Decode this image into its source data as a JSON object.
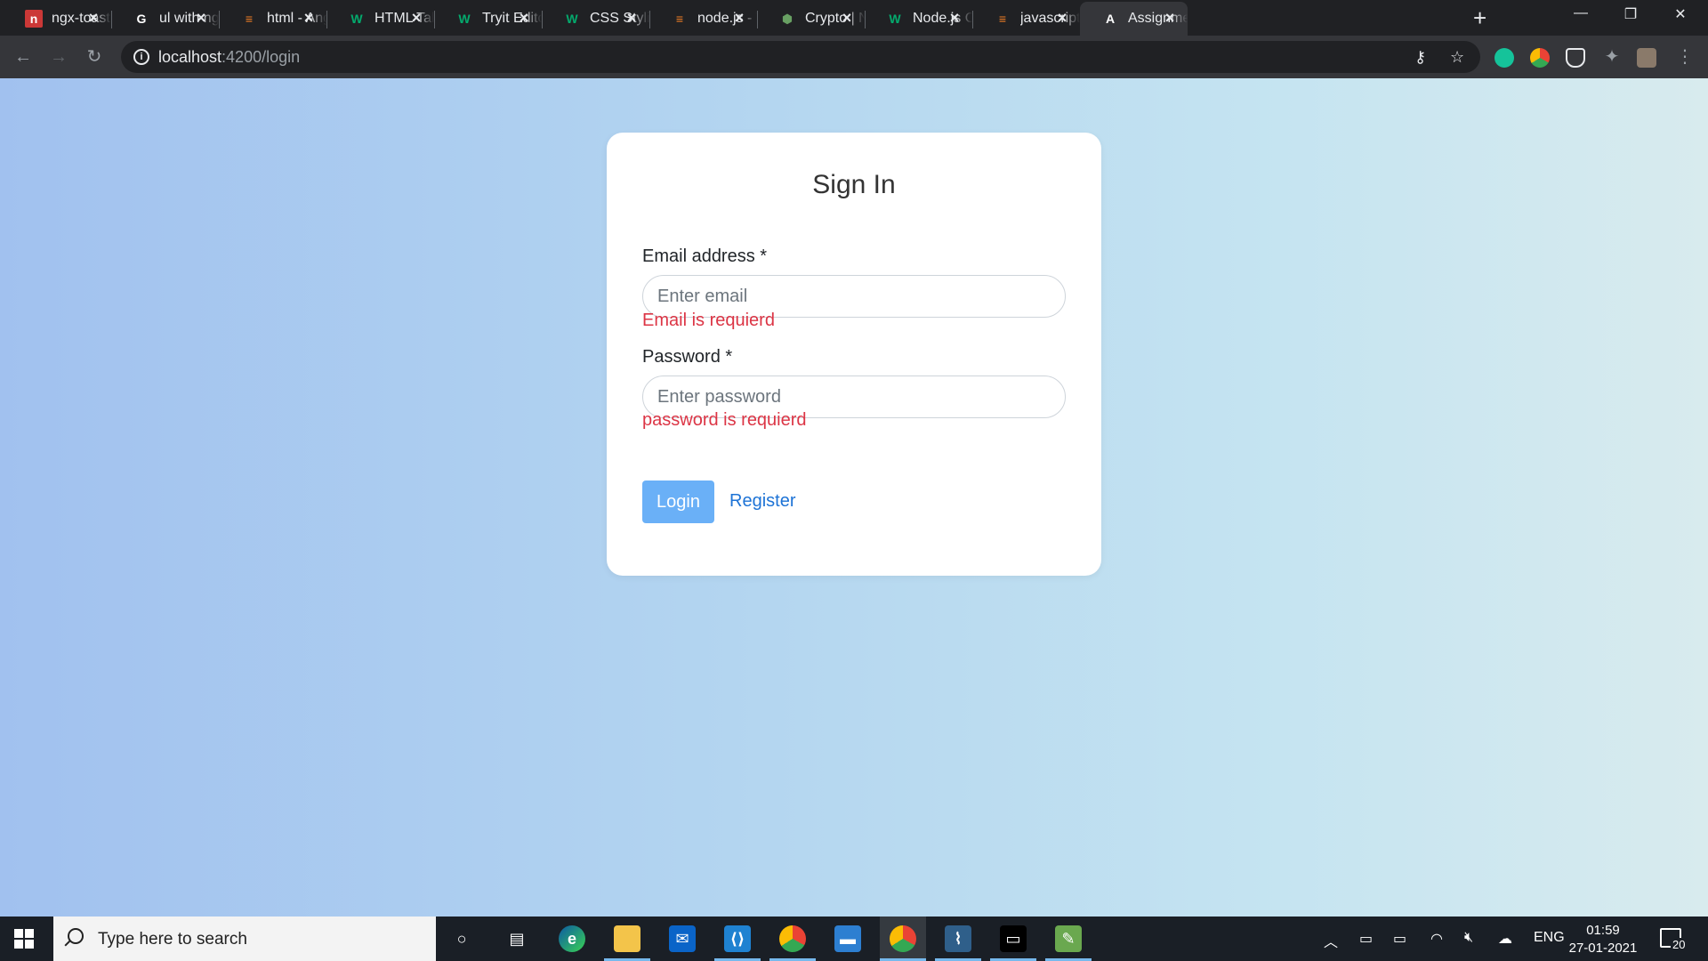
{
  "browser": {
    "tabs": [
      {
        "title": "ngx-toastr",
        "favicon": "npm-icon",
        "color": "#cb3837",
        "glyph": "n"
      },
      {
        "title": "ul with ngFor",
        "favicon": "google-icon",
        "color": "#ffffff",
        "glyph": "G"
      },
      {
        "title": "html - Angular",
        "favicon": "stackoverflow-icon",
        "color": "#f48024",
        "glyph": "≡"
      },
      {
        "title": "HTML Tables",
        "favicon": "w3schools-icon",
        "color": "#04aa6d",
        "glyph": "W"
      },
      {
        "title": "Tryit Editor",
        "favicon": "w3schools-icon",
        "color": "#04aa6d",
        "glyph": "W"
      },
      {
        "title": "CSS Styling",
        "favicon": "w3schools-icon",
        "color": "#04aa6d",
        "glyph": "W"
      },
      {
        "title": "node.js - T",
        "favicon": "stackoverflow-icon",
        "color": "#f48024",
        "glyph": "≡"
      },
      {
        "title": "Crypto | Node",
        "favicon": "nodejs-icon",
        "color": "#68a063",
        "glyph": "⬢"
      },
      {
        "title": "Node.js Crypto",
        "favicon": "w3schools-icon",
        "color": "#04aa6d",
        "glyph": "W"
      },
      {
        "title": "javascript",
        "favicon": "stackoverflow-icon",
        "color": "#f48024",
        "glyph": "≡"
      },
      {
        "title": "Assignment",
        "favicon": "angular-icon",
        "color": "#ffffff",
        "glyph": "A"
      }
    ],
    "active_tab_index": 10,
    "address": {
      "host": "localhost",
      "path": ":4200/login"
    }
  },
  "login": {
    "heading": "Sign In",
    "email_label": "Email address *",
    "email_placeholder": "Enter email",
    "email_value": "",
    "email_error": "Email is requierd",
    "password_label": "Password *",
    "password_placeholder": "Enter password",
    "password_value": "",
    "password_error": "password is requierd",
    "login_button": "Login",
    "register_link": "Register"
  },
  "taskbar": {
    "search_placeholder": "Type here to search",
    "apps": [
      "cortana-icon",
      "task-view-icon",
      "edge-icon",
      "file-explorer-icon",
      "mail-icon",
      "vscode-icon",
      "chrome-icon",
      "network-drive-icon",
      "chrome-profile-icon",
      "mysql-workbench-icon",
      "terminal-icon",
      "image-editor-icon"
    ],
    "language": "ENG",
    "time": "01:59",
    "date": "27-01-2021",
    "notification_count": "20"
  },
  "colors": {
    "accent": "#6ab0f7",
    "error": "#dc3545",
    "link": "#1d73d6"
  }
}
